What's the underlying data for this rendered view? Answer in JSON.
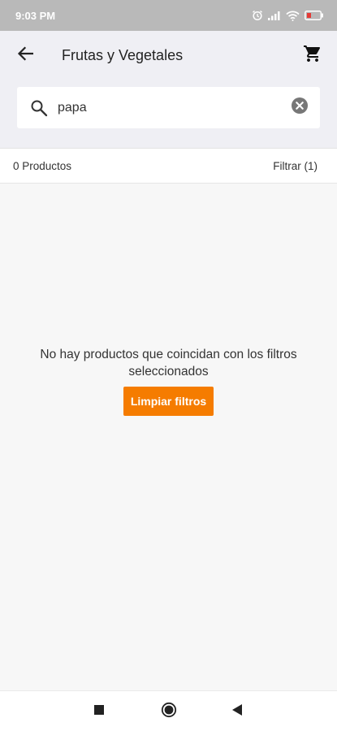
{
  "status_bar": {
    "time": "9:03 PM"
  },
  "header": {
    "title": "Frutas y Vegetales"
  },
  "search": {
    "value": "papa"
  },
  "results": {
    "count_label": "0 Productos",
    "filter_label": "Filtrar (1)"
  },
  "empty_state": {
    "message": "No hay productos que coincidan con los filtros seleccionados",
    "clear_button_label": "Limpiar filtros"
  },
  "colors": {
    "accent": "#f57c00",
    "header_bg": "#efeff4",
    "status_bg": "#b9b9b9"
  },
  "icons": [
    "alarm-icon",
    "signal-icon",
    "wifi-icon",
    "battery-icon",
    "back-arrow-icon",
    "cart-icon",
    "search-icon",
    "clear-icon",
    "recent-apps-icon",
    "home-icon",
    "back-triangle-icon"
  ]
}
